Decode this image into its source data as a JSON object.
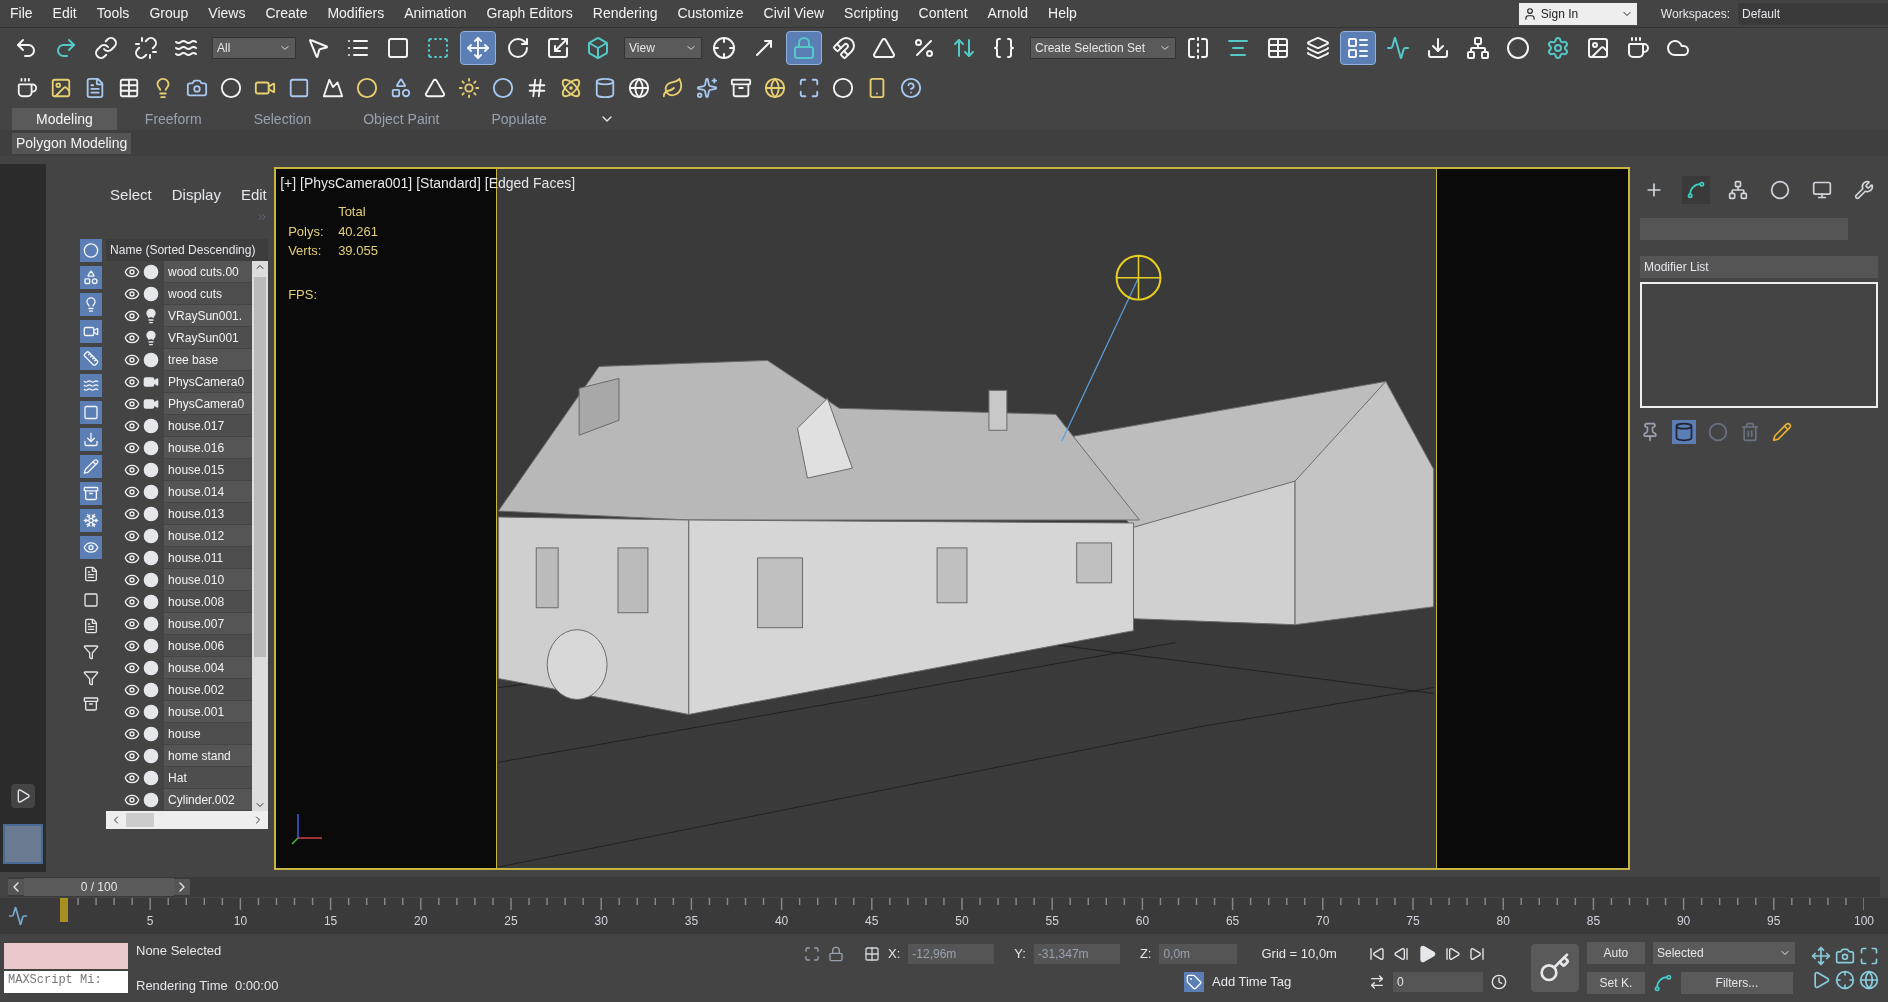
{
  "menu": [
    "File",
    "Edit",
    "Tools",
    "Group",
    "Views",
    "Create",
    "Modifiers",
    "Animation",
    "Graph Editors",
    "Rendering",
    "Customize",
    "Civil View",
    "Scripting",
    "Content",
    "Arnold",
    "Help"
  ],
  "account": {
    "sign_in": "Sign In",
    "workspaces_label": "Workspaces:",
    "workspace": "Default"
  },
  "toolbar": [
    {
      "kind": "button",
      "selected": false
    },
    {
      "kind": "button",
      "selected": false
    },
    {
      "kind": "button",
      "selected": false
    },
    {
      "kind": "button",
      "selected": false
    },
    {
      "kind": "button",
      "selected": false
    },
    {
      "kind": "dropdown",
      "value": "All"
    },
    {
      "kind": "button",
      "selected": false
    },
    {
      "kind": "button",
      "selected": false
    },
    {
      "kind": "button",
      "selected": false
    },
    {
      "kind": "button",
      "selected": false
    },
    {
      "kind": "button",
      "selected": true
    },
    {
      "kind": "button",
      "selected": false
    },
    {
      "kind": "button",
      "selected": false
    },
    {
      "kind": "button",
      "selected": false
    },
    {
      "kind": "dropdown",
      "value": "View"
    },
    {
      "kind": "button",
      "selected": false
    },
    {
      "kind": "button",
      "selected": false
    },
    {
      "kind": "button",
      "selected": true
    },
    {
      "kind": "button",
      "selected": false
    },
    {
      "kind": "button",
      "selected": false
    },
    {
      "kind": "button",
      "selected": false
    },
    {
      "kind": "button",
      "selected": false
    },
    {
      "kind": "button",
      "selected": false
    },
    {
      "kind": "dropdown",
      "value": "Create Selection Set"
    },
    {
      "kind": "button",
      "selected": false
    },
    {
      "kind": "button",
      "selected": false
    },
    {
      "kind": "button",
      "selected": false
    },
    {
      "kind": "button",
      "selected": false
    },
    {
      "kind": "button",
      "selected": true
    },
    {
      "kind": "button",
      "selected": false
    },
    {
      "kind": "button",
      "selected": false
    },
    {
      "kind": "button",
      "selected": false
    },
    {
      "kind": "button",
      "selected": false
    },
    {
      "kind": "button",
      "selected": false
    },
    {
      "kind": "button",
      "selected": false
    },
    {
      "kind": "button",
      "selected": false
    },
    {
      "kind": "button",
      "selected": false
    }
  ],
  "ribbon": {
    "tabs": [
      {
        "label": "Modeling",
        "selected": true
      },
      {
        "label": "Freeform",
        "selected": false
      },
      {
        "label": "Selection",
        "selected": false
      },
      {
        "label": "Object Paint",
        "selected": false
      },
      {
        "label": "Populate",
        "selected": false
      }
    ],
    "panel": "Polygon Modeling"
  },
  "explorer": {
    "tabs": [
      "Select",
      "Display",
      "Edit"
    ],
    "column": "Name (Sorted Descending)",
    "rows": [
      {
        "name": "wood cuts.00",
        "kind": "geometry"
      },
      {
        "name": "wood cuts",
        "kind": "geometry"
      },
      {
        "name": "VRaySun001.",
        "kind": "light"
      },
      {
        "name": "VRaySun001",
        "kind": "light"
      },
      {
        "name": "tree base",
        "kind": "geometry"
      },
      {
        "name": "PhysCamera0",
        "kind": "camera"
      },
      {
        "name": "PhysCamera0",
        "kind": "camera"
      },
      {
        "name": "house.017",
        "kind": "geometry"
      },
      {
        "name": "house.016",
        "kind": "geometry"
      },
      {
        "name": "house.015",
        "kind": "geometry"
      },
      {
        "name": "house.014",
        "kind": "geometry"
      },
      {
        "name": "house.013",
        "kind": "geometry"
      },
      {
        "name": "house.012",
        "kind": "geometry"
      },
      {
        "name": "house.011",
        "kind": "geometry"
      },
      {
        "name": "house.010",
        "kind": "geometry"
      },
      {
        "name": "house.008",
        "kind": "geometry"
      },
      {
        "name": "house.007",
        "kind": "geometry"
      },
      {
        "name": "house.006",
        "kind": "geometry"
      },
      {
        "name": "house.004",
        "kind": "geometry"
      },
      {
        "name": "house.002",
        "kind": "geometry"
      },
      {
        "name": "house.001",
        "kind": "geometry"
      },
      {
        "name": "house",
        "kind": "geometry"
      },
      {
        "name": "home stand",
        "kind": "geometry"
      },
      {
        "name": "Hat",
        "kind": "geometry"
      },
      {
        "name": "Cylinder.002",
        "kind": "geometry"
      }
    ]
  },
  "viewport": {
    "labels": [
      "[+]",
      "[PhysCamera001]",
      "[Standard]",
      "[Edged Faces]"
    ],
    "stats_header": "Total",
    "stats": [
      {
        "label": "Polys:",
        "value": "40.261"
      },
      {
        "label": "Verts:",
        "value": "39.055"
      }
    ],
    "fps": "FPS:"
  },
  "command_panel": {
    "tabs": [
      {
        "selected": false
      },
      {
        "selected": true
      },
      {
        "selected": false
      },
      {
        "selected": false
      },
      {
        "selected": false
      },
      {
        "selected": false
      }
    ],
    "modifier_list": "Modifier List"
  },
  "timeline": {
    "frame": "0 / 100",
    "ticks": [
      "5",
      "10",
      "15",
      "20",
      "25",
      "30",
      "35",
      "40",
      "45",
      "50",
      "55",
      "60",
      "65",
      "70",
      "75",
      "80",
      "85",
      "90",
      "95",
      "100"
    ]
  },
  "status": {
    "maxscript": "MAXScript Mi:",
    "selection": "None Selected",
    "render_time": "Rendering Time  0:00:00",
    "x_label": "X:",
    "x": "-12,96m",
    "y_label": "Y:",
    "y": "-31,347m",
    "z_label": "Z:",
    "z": "0,0m",
    "grid": "Grid = 10,0m",
    "time_tag": "Add Time Tag",
    "auto": "Auto",
    "set_key": "Set K.",
    "key_filter": "Selected",
    "filters": "Filters...",
    "frame": "0"
  }
}
